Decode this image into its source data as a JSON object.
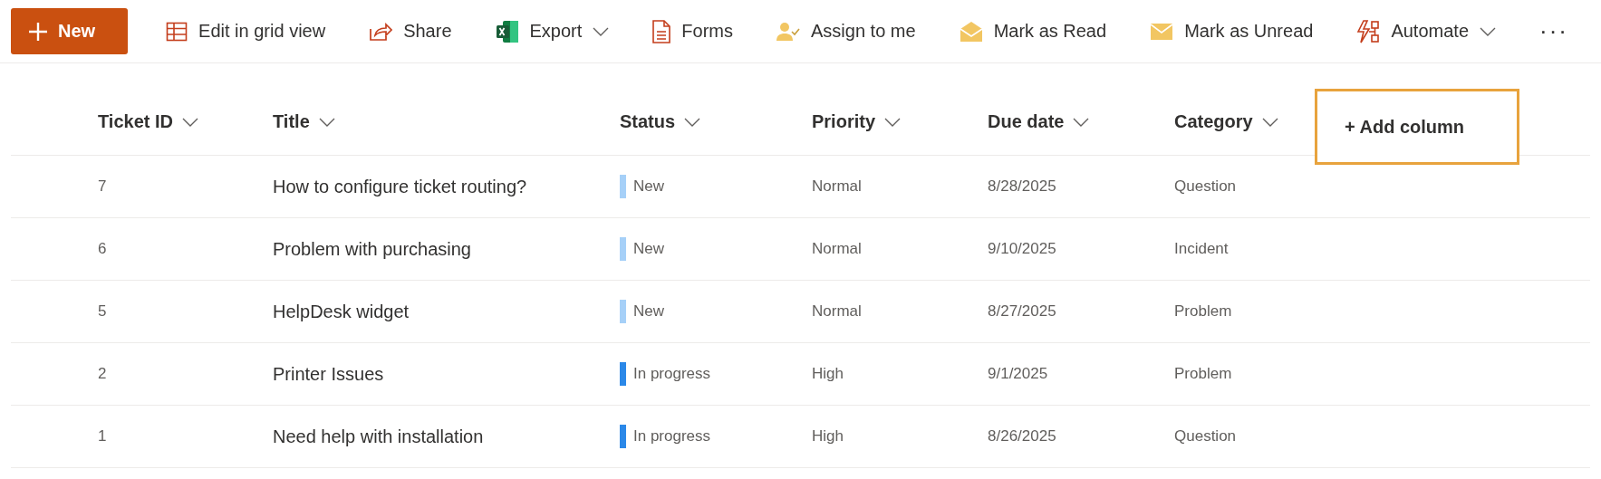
{
  "toolbar": [
    {
      "label": "New",
      "kind": "primary",
      "menu": false
    },
    {
      "label": "Edit in grid view",
      "kind": "grid",
      "menu": false
    },
    {
      "label": "Share",
      "kind": "share",
      "menu": false
    },
    {
      "label": "Export",
      "kind": "excel",
      "menu": true
    },
    {
      "label": "Forms",
      "kind": "forms",
      "menu": false
    },
    {
      "label": "Assign to me",
      "kind": "person",
      "menu": false
    },
    {
      "label": "Mark as Read",
      "kind": "open-mail",
      "menu": false
    },
    {
      "label": "Mark as Unread",
      "kind": "mail",
      "menu": false
    },
    {
      "label": "Automate",
      "kind": "automate",
      "menu": true
    },
    {
      "label": "···",
      "kind": "more",
      "menu": false
    }
  ],
  "table": {
    "columns": [
      "Ticket ID",
      "Title",
      "Status",
      "Priority",
      "Due date",
      "Category"
    ],
    "add_column": "+ Add column",
    "rows": [
      {
        "cells": [
          "7",
          "How to configure ticket routing?",
          "New",
          "Normal",
          "8/28/2025",
          "Question"
        ],
        "color": "#a6d0f8"
      },
      {
        "cells": [
          "6",
          "Problem with purchasing",
          "New",
          "Normal",
          "9/10/2025",
          "Incident"
        ],
        "color": "#a6d0f8"
      },
      {
        "cells": [
          "5",
          "HelpDesk widget",
          "New",
          "Normal",
          "8/27/2025",
          "Problem"
        ],
        "color": "#a6d0f8"
      },
      {
        "cells": [
          "2",
          "Printer Issues",
          "In progress",
          "High",
          "9/1/2025",
          "Problem"
        ],
        "color": "#2b88e8"
      },
      {
        "cells": [
          "1",
          "Need help with installation",
          "In progress",
          "High",
          "8/26/2025",
          "Question"
        ],
        "color": "#2b88e8"
      }
    ]
  }
}
